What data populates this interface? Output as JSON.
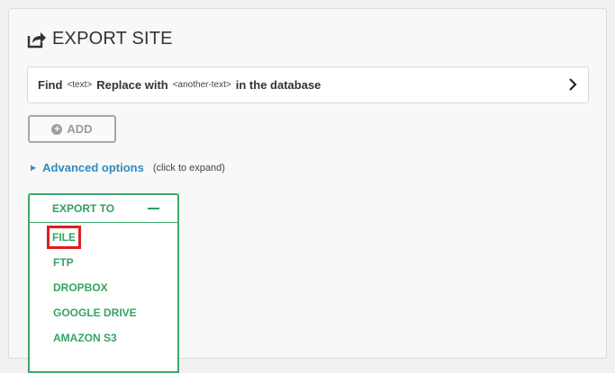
{
  "page": {
    "title": "EXPORT SITE",
    "title_icon": "export-icon"
  },
  "find_replace": {
    "find_label": "Find",
    "find_placeholder": "<text>",
    "replace_label": "Replace with",
    "replace_placeholder": "<another-text>",
    "suffix": "in the database",
    "chevron_icon": "chevron-right-icon"
  },
  "add_button": {
    "label": "ADD",
    "icon": "plus-circle-icon"
  },
  "advanced": {
    "label": "Advanced options",
    "hint": "(click to expand)"
  },
  "export_to": {
    "header": "EXPORT TO",
    "collapse_icon": "minus-icon",
    "items": [
      "FILE",
      "FTP",
      "DROPBOX",
      "GOOGLE DRIVE",
      "AMAZON S3"
    ],
    "selected": "FILE"
  },
  "colors": {
    "accent_green": "#3aab6b",
    "link_blue": "#2f8bbd",
    "highlight_red": "#e01e1e"
  }
}
